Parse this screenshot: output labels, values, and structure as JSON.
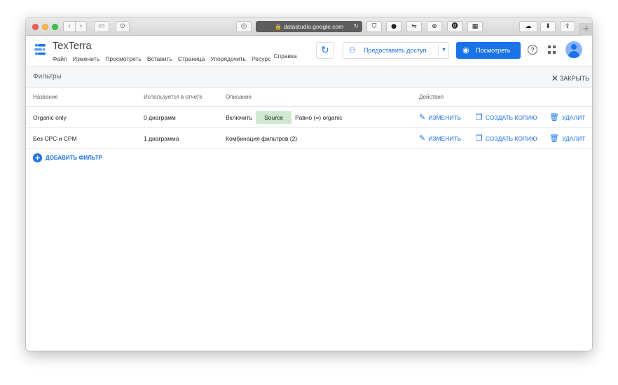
{
  "browser": {
    "address": "datastudio.google.com",
    "lock_icon": "🔒",
    "reload_icon": "↻",
    "nav_back": "‹",
    "nav_forward": "›",
    "new_tab": "+"
  },
  "app": {
    "title": "TexTerra",
    "menu": [
      "Файл",
      "Изменить",
      "Просмотреть",
      "Вставить",
      "Страница",
      "Упорядочить",
      "Ресурс",
      "Справка"
    ],
    "share_label": "Предоставить доступ",
    "view_label": "Посмотреть",
    "help_glyph": "?"
  },
  "filters": {
    "title": "Фильтры",
    "close_label": "ЗАКРЫТЬ",
    "columns": [
      "Название",
      "Используется в отчете",
      "Описание",
      "Действия"
    ],
    "rows": [
      {
        "name": "Organic only",
        "usage": "0 диаграмм",
        "desc_prefix": "Включить",
        "chip": "Source",
        "desc_suffix": "Равно (=) organic"
      },
      {
        "name": "Без CPC и CPM",
        "usage": "1 диаграмма",
        "desc": "Комбинация фильтров (2)"
      }
    ],
    "actions": {
      "edit": "ИЗМЕНИТЬ",
      "copy": "СОЗДАТЬ КОПИЮ",
      "delete": "УДАЛИТ"
    },
    "add_label": "ДОБАВИТЬ ФИЛЬТР"
  },
  "colors": {
    "accent": "#1a73e8",
    "chip": "#cfe8cf"
  }
}
